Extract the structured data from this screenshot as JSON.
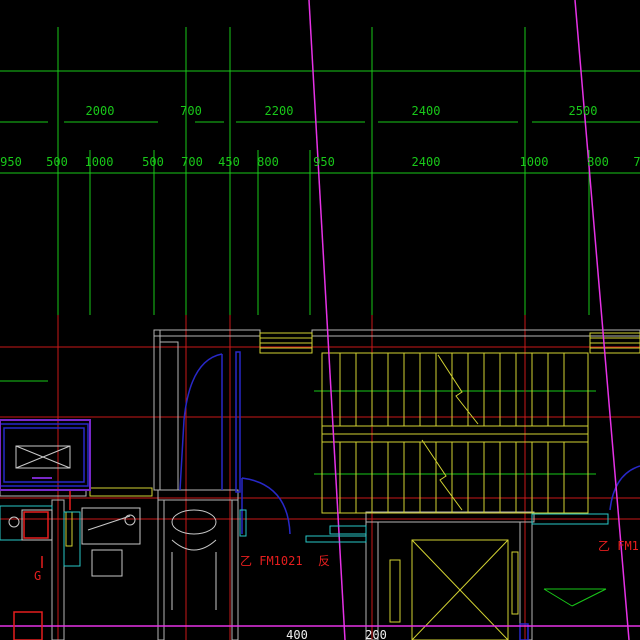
{
  "colors": {
    "background": "#000000",
    "dimension": "#19c819",
    "axis": "#c81919",
    "wall": "#b4b4b4",
    "stair": "#d2d232",
    "door": "#2828c8",
    "magenta": "#e632e6",
    "cyan": "#28c8c8",
    "annotation": "#e61e1e",
    "bottom_dim": "#f0f0f0"
  },
  "dimensions": {
    "row1": [
      "2000",
      "700",
      "2200",
      "2400",
      "2500"
    ],
    "row2": [
      "950",
      "500",
      "1000",
      "500",
      "700",
      "450",
      "800",
      "950",
      "2400",
      "1000",
      "800",
      "7"
    ],
    "bottom": [
      "400",
      "200"
    ]
  },
  "labels": {
    "door_tag_1": "乙 FM1021",
    "door_tag_1_suffix": "反",
    "door_tag_2": "乙 FM1",
    "column_mark": "G"
  }
}
